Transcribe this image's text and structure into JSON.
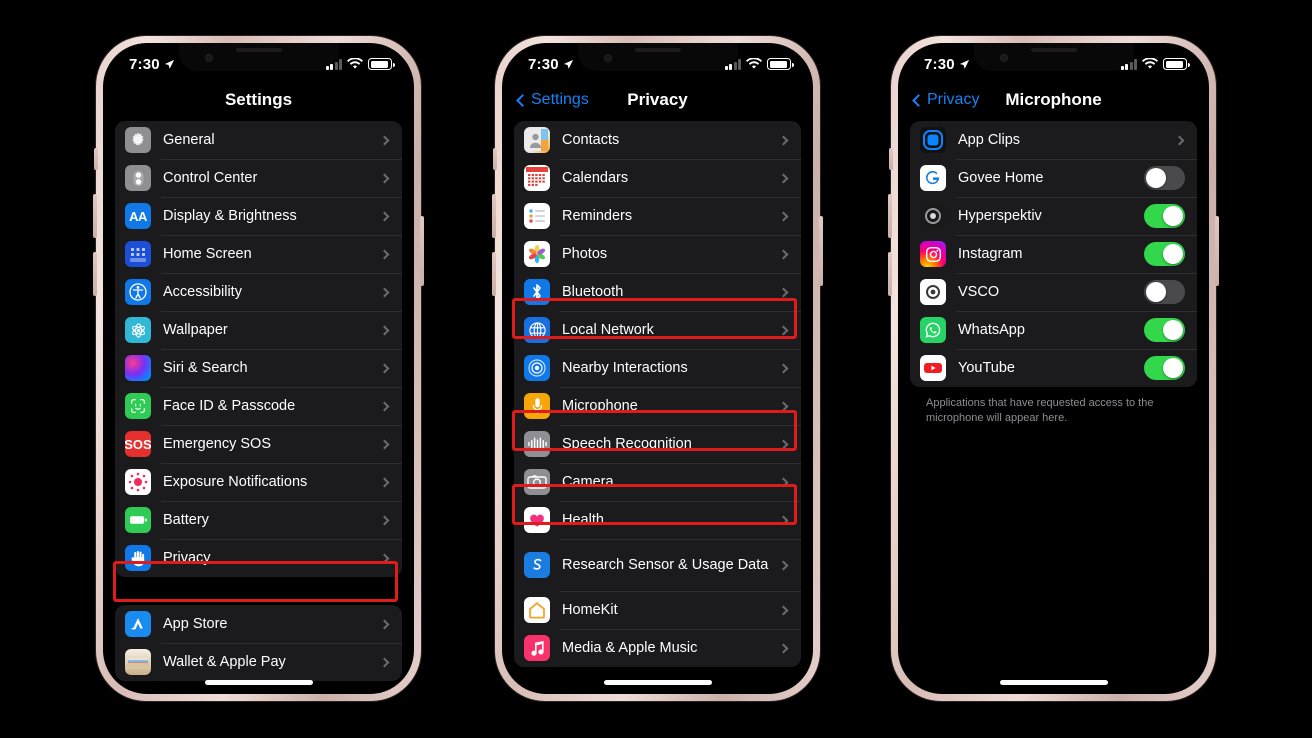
{
  "colors": {
    "accent_blue": "#1782f5",
    "toggle_on": "#32d74b",
    "toggle_off": "#4a4a4e",
    "highlight_red": "#e01b1b",
    "list_bg": "#1b1b1d",
    "page_bg": "#000000"
  },
  "status_bar": {
    "time": "7:30",
    "location_icon": "location-arrow-icon",
    "signal_bars": 2,
    "signal_bars_total": 4,
    "wifi": "wifi-icon",
    "battery": "battery-full-icon"
  },
  "phone1": {
    "nav": {
      "title": "Settings",
      "back_label": null
    },
    "groups": [
      {
        "rows": [
          {
            "label": "General",
            "icon": "gear-icon",
            "accessory": "chevron"
          },
          {
            "label": "Control Center",
            "icon": "control-center-icon",
            "accessory": "chevron"
          },
          {
            "label": "Display & Brightness",
            "icon": "display-brightness-icon",
            "accessory": "chevron"
          },
          {
            "label": "Home Screen",
            "icon": "home-screen-icon",
            "accessory": "chevron"
          },
          {
            "label": "Accessibility",
            "icon": "accessibility-icon",
            "accessory": "chevron"
          },
          {
            "label": "Wallpaper",
            "icon": "wallpaper-icon",
            "accessory": "chevron"
          },
          {
            "label": "Siri & Search",
            "icon": "siri-icon",
            "accessory": "chevron"
          },
          {
            "label": "Face ID & Passcode",
            "icon": "face-id-icon",
            "accessory": "chevron"
          },
          {
            "label": "Emergency SOS",
            "icon": "emergency-sos-icon",
            "accessory": "chevron"
          },
          {
            "label": "Exposure Notifications",
            "icon": "exposure-notifications-icon",
            "accessory": "chevron"
          },
          {
            "label": "Battery",
            "icon": "battery-icon",
            "accessory": "chevron"
          },
          {
            "label": "Privacy",
            "icon": "privacy-hand-icon",
            "accessory": "chevron",
            "highlighted": true
          }
        ]
      },
      {
        "rows": [
          {
            "label": "App Store",
            "icon": "app-store-icon",
            "accessory": "chevron"
          },
          {
            "label": "Wallet & Apple Pay",
            "icon": "wallet-icon",
            "accessory": "chevron"
          }
        ]
      }
    ]
  },
  "phone2": {
    "nav": {
      "title": "Privacy",
      "back_label": "Settings"
    },
    "groups": [
      {
        "rows": [
          {
            "label": "Contacts",
            "icon": "contacts-icon",
            "accessory": "chevron"
          },
          {
            "label": "Calendars",
            "icon": "calendar-icon",
            "accessory": "chevron"
          },
          {
            "label": "Reminders",
            "icon": "reminders-icon",
            "accessory": "chevron"
          },
          {
            "label": "Photos",
            "icon": "photos-icon",
            "accessory": "chevron"
          },
          {
            "label": "Bluetooth",
            "icon": "bluetooth-icon",
            "accessory": "chevron",
            "highlighted": true
          },
          {
            "label": "Local Network",
            "icon": "local-network-icon",
            "accessory": "chevron"
          },
          {
            "label": "Nearby Interactions",
            "icon": "nearby-interactions-icon",
            "accessory": "chevron"
          },
          {
            "label": "Microphone",
            "icon": "microphone-icon",
            "accessory": "chevron",
            "highlighted": true
          },
          {
            "label": "Speech Recognition",
            "icon": "speech-recognition-icon",
            "accessory": "chevron"
          },
          {
            "label": "Camera",
            "icon": "camera-icon",
            "accessory": "chevron",
            "highlighted": true
          },
          {
            "label": "Health",
            "icon": "health-icon",
            "accessory": "chevron"
          },
          {
            "label": "Research Sensor & Usage Data",
            "icon": "research-sensor-icon",
            "accessory": "chevron",
            "tall": true
          },
          {
            "label": "HomeKit",
            "icon": "homekit-icon",
            "accessory": "chevron"
          },
          {
            "label": "Media & Apple Music",
            "icon": "media-apple-music-icon",
            "accessory": "chevron"
          }
        ]
      }
    ]
  },
  "phone3": {
    "nav": {
      "title": "Microphone",
      "back_label": "Privacy"
    },
    "groups": [
      {
        "rows": [
          {
            "label": "App Clips",
            "icon": "app-clips-icon",
            "accessory": "chevron"
          },
          {
            "label": "Govee Home",
            "icon": "govee-home-icon",
            "accessory": "toggle",
            "toggle": "off"
          },
          {
            "label": "Hyperspektiv",
            "icon": "hyperspektiv-icon",
            "accessory": "toggle",
            "toggle": "on"
          },
          {
            "label": "Instagram",
            "icon": "instagram-icon",
            "accessory": "toggle",
            "toggle": "on"
          },
          {
            "label": "VSCO",
            "icon": "vsco-icon",
            "accessory": "toggle",
            "toggle": "off"
          },
          {
            "label": "WhatsApp",
            "icon": "whatsapp-icon",
            "accessory": "toggle",
            "toggle": "on"
          },
          {
            "label": "YouTube",
            "icon": "youtube-icon",
            "accessory": "toggle",
            "toggle": "on"
          }
        ]
      }
    ],
    "footnote": "Applications that have requested access to the microphone will appear here."
  }
}
